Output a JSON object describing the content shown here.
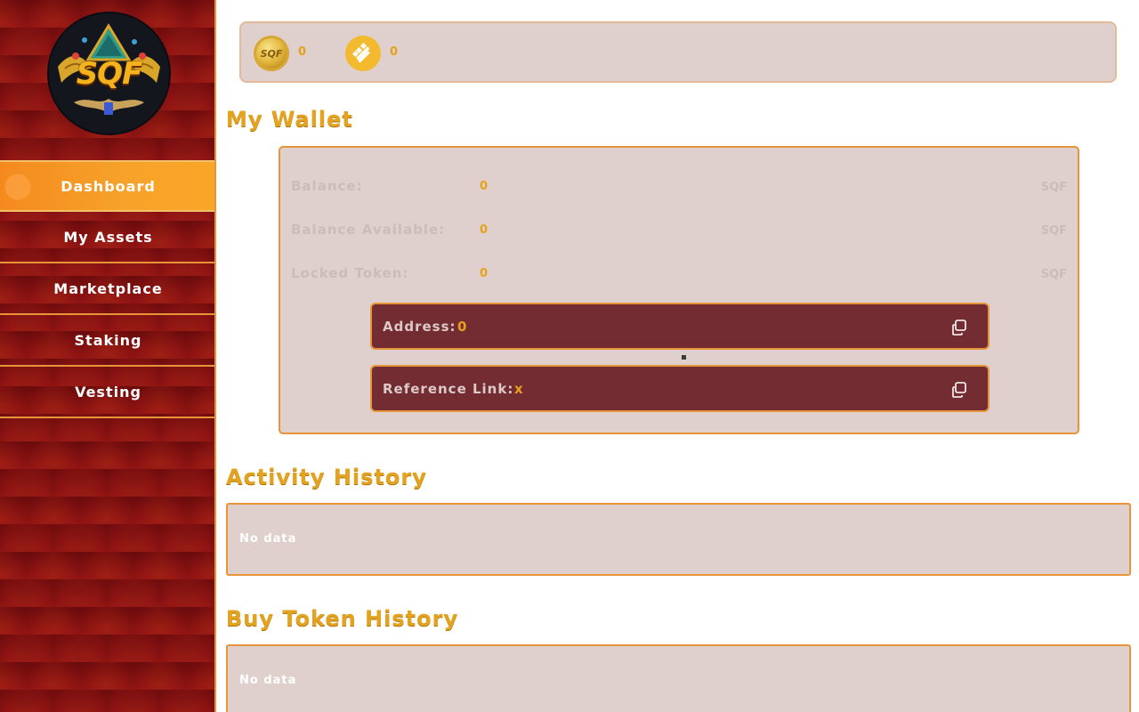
{
  "sidebar": {
    "logo_text": "SQF",
    "items": [
      {
        "label": "Dashboard",
        "active": true
      },
      {
        "label": "My Assets"
      },
      {
        "label": "Marketplace"
      },
      {
        "label": "Staking"
      },
      {
        "label": "Vesting"
      }
    ]
  },
  "balances": {
    "sqf": {
      "icon": "sqf-coin-icon",
      "value": "0"
    },
    "busd": {
      "icon": "busd-coin-icon",
      "value": "0"
    }
  },
  "wallet": {
    "title": "My Wallet",
    "rows": [
      {
        "label": "Balance:",
        "value": "0",
        "unit": "SQF"
      },
      {
        "label": "Balance Available:",
        "value": "0",
        "unit": "SQF"
      },
      {
        "label": "Locked Token:",
        "value": "0",
        "unit": "SQF"
      }
    ],
    "address": {
      "label": "Address:",
      "value": "0"
    },
    "reference": {
      "label": "Reference Link:",
      "value": "x"
    }
  },
  "activity": {
    "title": "Activity History",
    "empty_text": "No data"
  },
  "buy_token": {
    "title": "Buy Token History",
    "empty_text": "No data"
  },
  "colors": {
    "accent": "#e3a321",
    "nav_active": "#f7a32a",
    "panel": "#dfd0cd",
    "address_bg": "#722c32",
    "border": "#e8953a"
  }
}
